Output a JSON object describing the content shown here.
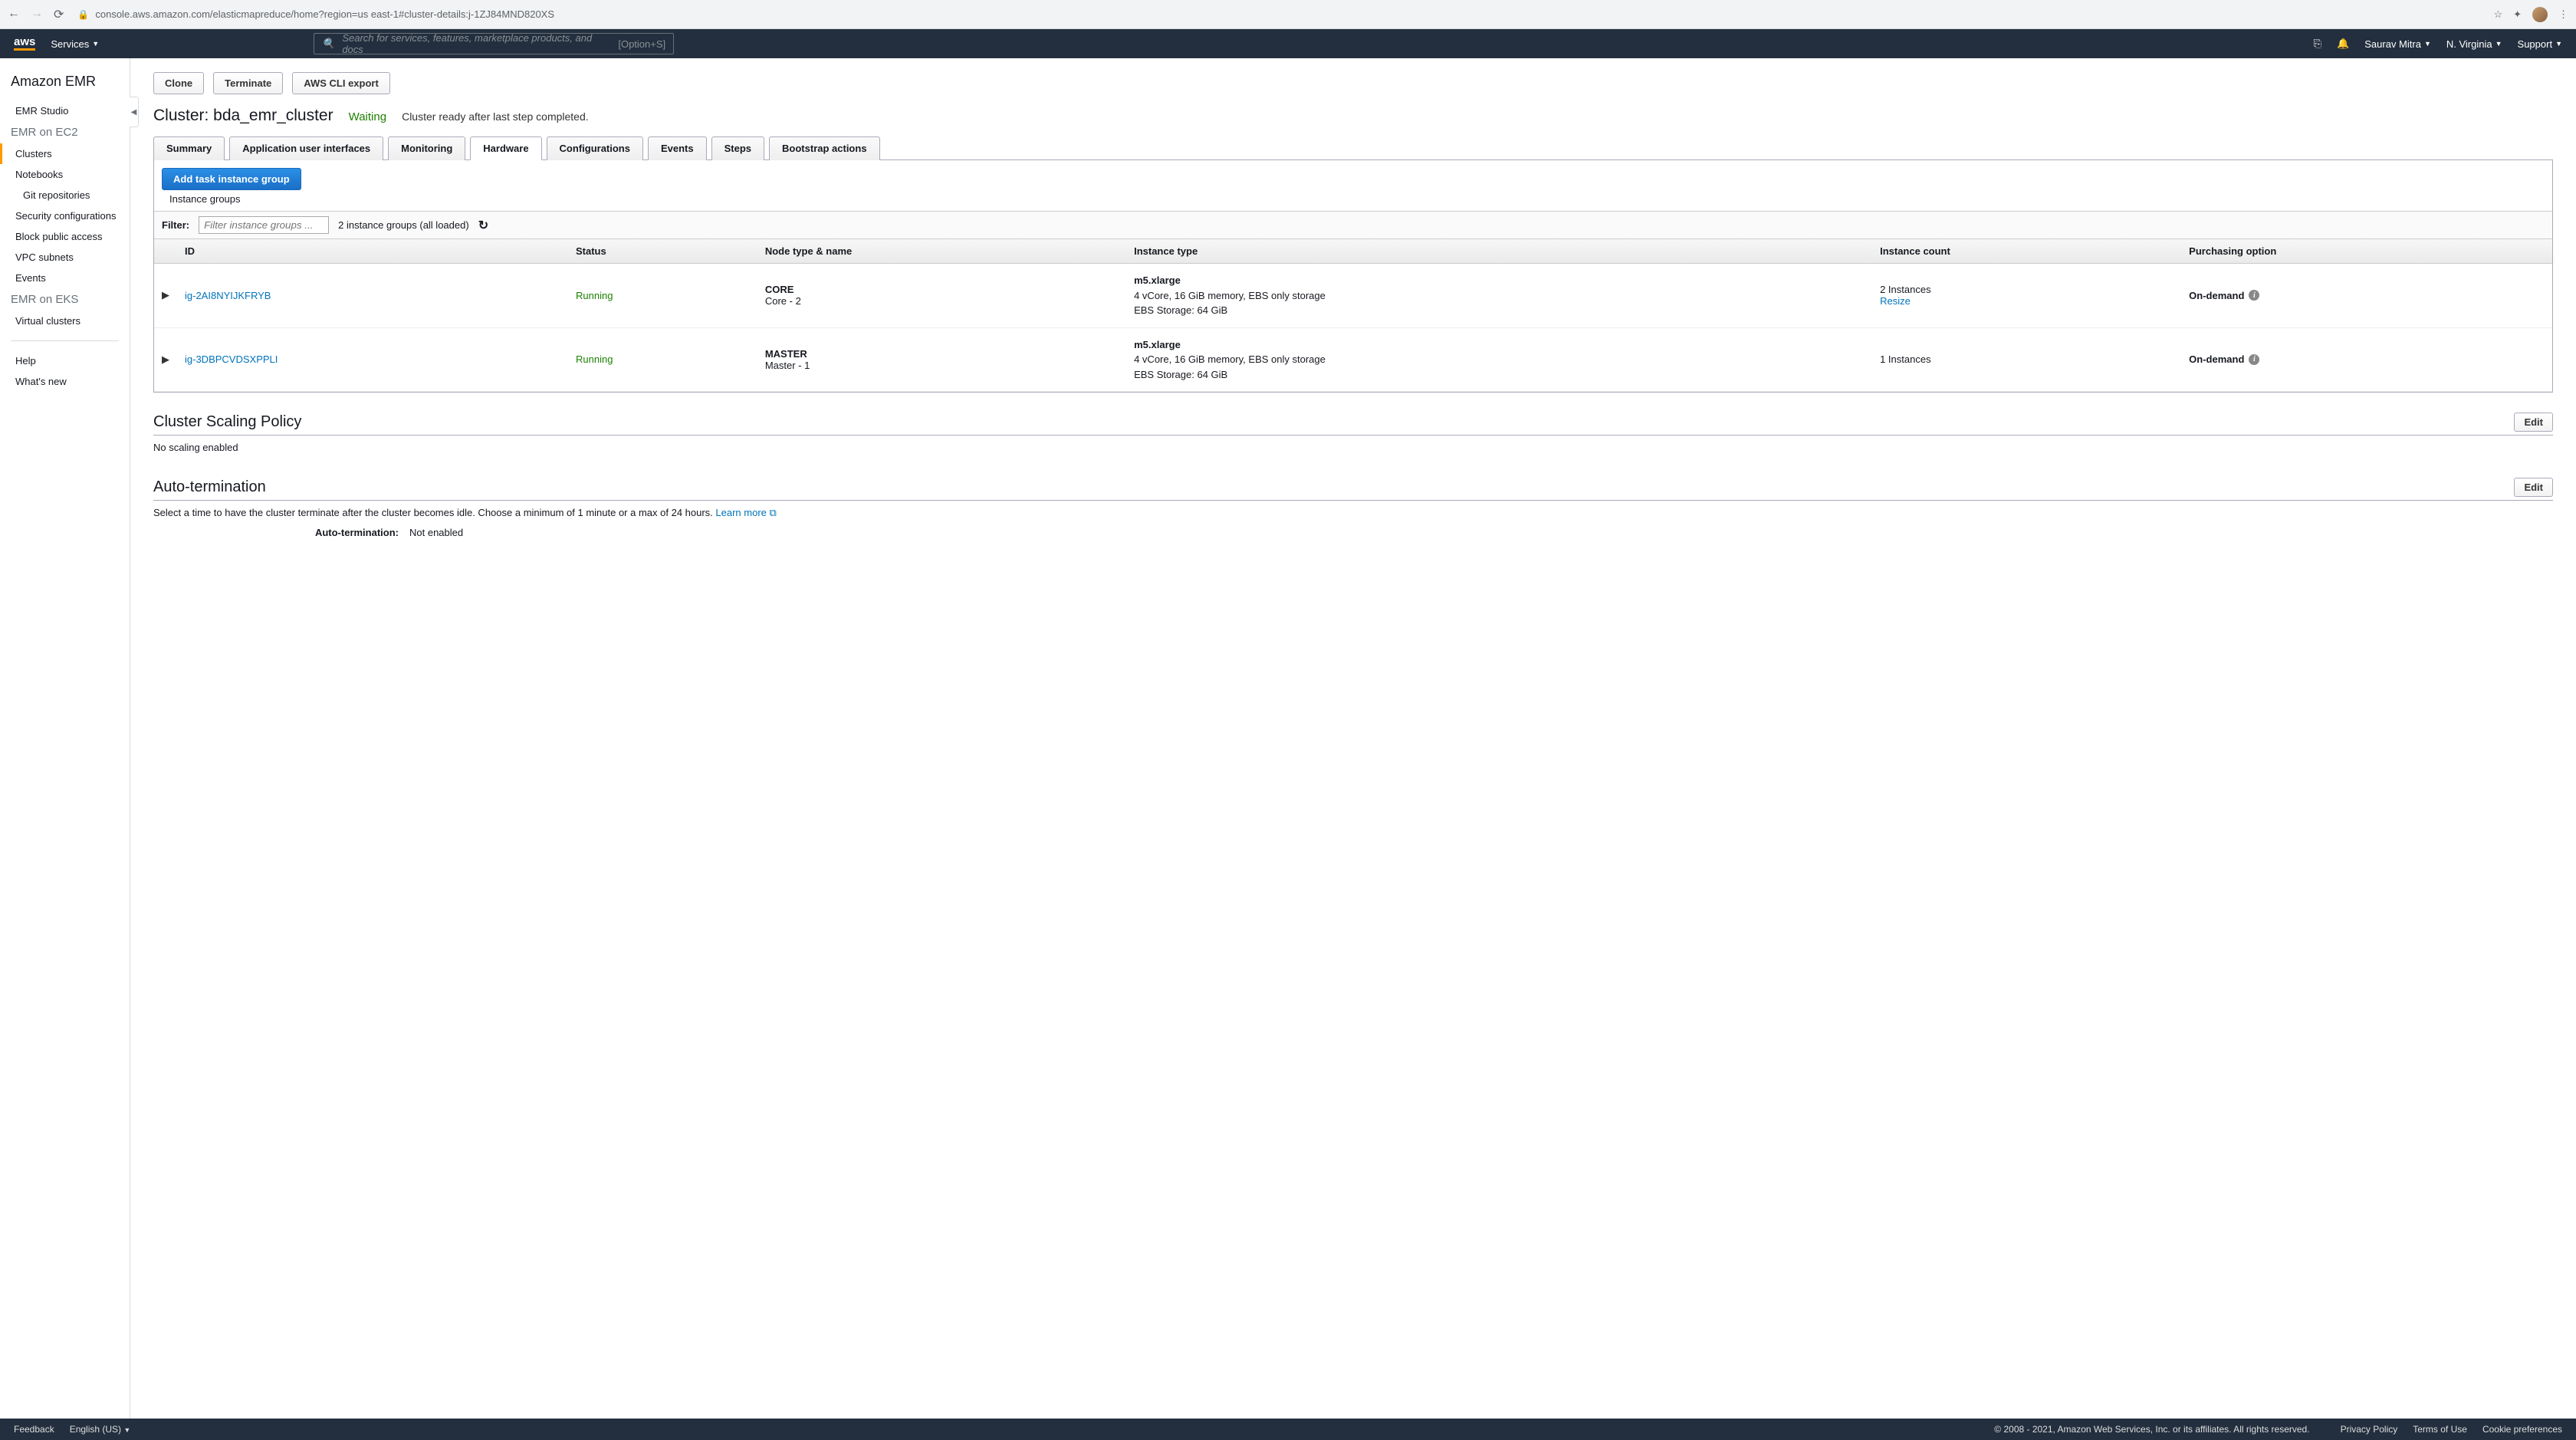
{
  "browser": {
    "url": "console.aws.amazon.com/elasticmapreduce/home?region=us east-1#cluster-details:j-1ZJ84MND820XS"
  },
  "nav": {
    "services": "Services",
    "search_placeholder": "Search for services, features, marketplace products, and docs",
    "search_hint": "[Option+S]",
    "user": "Saurav Mitra",
    "region": "N. Virginia",
    "support": "Support"
  },
  "sidebar": {
    "title": "Amazon EMR",
    "groups": [
      {
        "label": "",
        "items": [
          {
            "label": "EMR Studio"
          }
        ]
      },
      {
        "label": "EMR on EC2",
        "items": [
          {
            "label": "Clusters",
            "active": true
          },
          {
            "label": "Notebooks"
          },
          {
            "label": "Git repositories",
            "sub": true
          },
          {
            "label": "Security configurations"
          },
          {
            "label": "Block public access"
          },
          {
            "label": "VPC subnets"
          },
          {
            "label": "Events"
          }
        ]
      },
      {
        "label": "EMR on EKS",
        "items": [
          {
            "label": "Virtual clusters"
          }
        ]
      }
    ],
    "footer_items": [
      "Help",
      "What's new"
    ]
  },
  "actions": {
    "clone": "Clone",
    "terminate": "Terminate",
    "cli_export": "AWS CLI export"
  },
  "cluster": {
    "title": "Cluster: bda_emr_cluster",
    "status": "Waiting",
    "status_msg": "Cluster ready after last step completed."
  },
  "tabs": [
    "Summary",
    "Application user interfaces",
    "Monitoring",
    "Hardware",
    "Configurations",
    "Events",
    "Steps",
    "Bootstrap actions"
  ],
  "active_tab": "Hardware",
  "hardware": {
    "add_button": "Add task instance group",
    "instance_groups_label": "Instance groups",
    "filter_label": "Filter:",
    "filter_placeholder": "Filter instance groups ...",
    "count_text": "2 instance groups (all loaded)",
    "columns": [
      "ID",
      "Status",
      "Node type & name",
      "Instance type",
      "Instance count",
      "Purchasing option"
    ],
    "rows": [
      {
        "id": "ig-2AI8NYIJKFRYB",
        "status": "Running",
        "node_type": "CORE",
        "node_name": "Core - 2",
        "instance_type": "m5.xlarge",
        "instance_spec": "4 vCore, 16 GiB memory, EBS only storage",
        "ebs": "EBS Storage:   64 GiB",
        "count": "2 Instances",
        "resize": "Resize",
        "purchasing": "On-demand"
      },
      {
        "id": "ig-3DBPCVDSXPPLI",
        "status": "Running",
        "node_type": "MASTER",
        "node_name": "Master - 1",
        "instance_type": "m5.xlarge",
        "instance_spec": "4 vCore, 16 GiB memory, EBS only storage",
        "ebs": "EBS Storage:   64 GiB",
        "count": "1 Instances",
        "resize": "",
        "purchasing": "On-demand"
      }
    ]
  },
  "scaling": {
    "title": "Cluster Scaling Policy",
    "edit": "Edit",
    "body": "No scaling enabled"
  },
  "auto_term": {
    "title": "Auto-termination",
    "edit": "Edit",
    "desc": "Select a time to have the cluster terminate after the cluster becomes idle. Choose a minimum of 1 minute or a max of 24 hours. ",
    "learn_more": "Learn more",
    "kv_label": "Auto-termination:",
    "kv_value": "Not enabled"
  },
  "footer": {
    "feedback": "Feedback",
    "lang": "English (US)",
    "copyright": "© 2008 - 2021, Amazon Web Services, Inc. or its affiliates. All rights reserved.",
    "links": [
      "Privacy Policy",
      "Terms of Use",
      "Cookie preferences"
    ]
  }
}
